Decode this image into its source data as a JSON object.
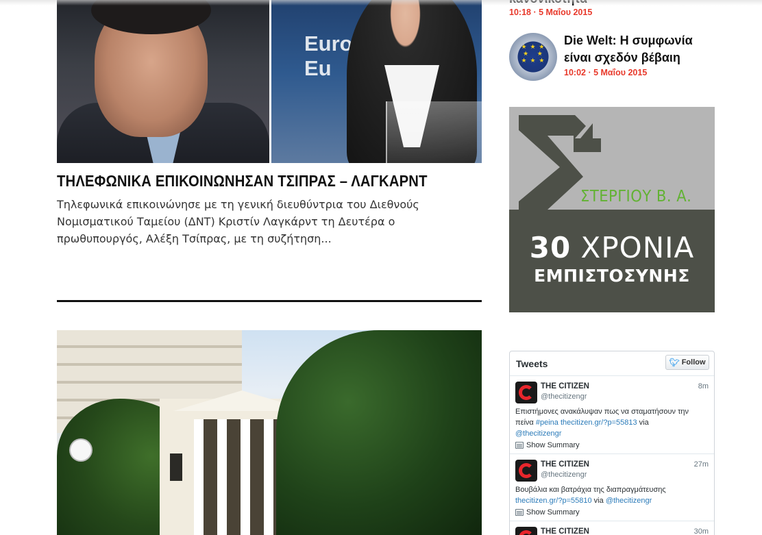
{
  "main": {
    "article": {
      "title": "ΤΗΛΕΦΩΝΙΚΑ ΕΠΙΚΟΙΝΩΝΗΣΑΝ ΤΣΙΠΡΑΣ – ΛΑΓΚΑΡΝΤ",
      "excerpt": "Τηλεφωνικά επικοινώνησε με τη γενική διευθύντρια του Διεθνούς Νομισματικού Ταμείου (ΔΝΤ) Κριστίν Λαγκάρντ τη Δευτέρα ο πρωθυπουργός, Αλέξη Τσίπρας, με τη συζήτηση...",
      "image_text": "Eurogr\nEu"
    }
  },
  "sidebar": {
    "top_item": {
      "title": "κανονικότητα",
      "meta": "10:18 · 5 Μαΐου 2015"
    },
    "item": {
      "title": "Die Welt: Η συμφωνία είναι σχεδόν βέβαιη",
      "meta": "10:02 · 5 Μαΐου 2015",
      "thumb_icon": "eu-flag-icon"
    },
    "ad": {
      "company": "ΣΤΕΡΓΙΟΥ Β. Α.",
      "years_number": "30",
      "years_word": "ΧΡΟΝΙΑ",
      "trust": "ΕΜΠΙΣΤΟΣΥΝΗΣ",
      "colors": {
        "green": "#62b233",
        "dark": "#4d5048",
        "light": "#b5b5b5"
      }
    },
    "twitter": {
      "title": "Tweets",
      "follow_label": "Follow",
      "tweets": [
        {
          "name": "THE CITIZEN",
          "handle": "@thecitizengr",
          "time": "8m",
          "text": "Επιστήμονες ανακάλυψαν πως να σταματήσουν την πείνα ",
          "hashtag": "#peina",
          "link": "thecitizen.gr/?p=55813",
          "via": " via ",
          "mention": "@thecitizengr",
          "summary": "Show Summary"
        },
        {
          "name": "THE CITIZEN",
          "handle": "@thecitizengr",
          "time": "27m",
          "text": "Βουβάλια και βατράχια της διαπραγμάτευσης ",
          "link": "thecitizen.gr/?p=55810",
          "via": " via ",
          "mention": "@thecitizengr",
          "summary": "Show Summary"
        },
        {
          "name": "THE CITIZEN",
          "handle": "",
          "time": "30m",
          "text": ""
        }
      ]
    }
  },
  "colors": {
    "accent_red": "#e8392b",
    "twitter_blue": "#2b7bb9"
  }
}
